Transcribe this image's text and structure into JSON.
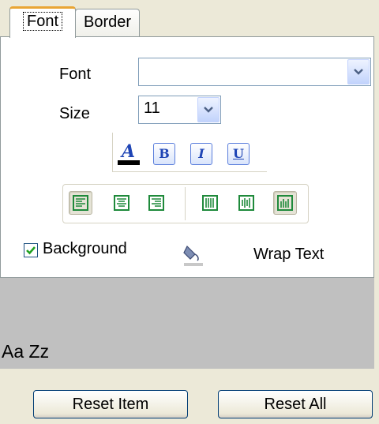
{
  "tabs": [
    {
      "label": "Font",
      "active": true
    },
    {
      "label": "Border",
      "active": false
    }
  ],
  "font": {
    "label": "Font",
    "value": ""
  },
  "size": {
    "label": "Size",
    "value": "11"
  },
  "style_buttons": [
    "B",
    "I",
    "U"
  ],
  "background": {
    "label": "Background",
    "checked": true
  },
  "wrap_text": {
    "label": "Wrap Text"
  },
  "preview": {
    "text": "Aa Zz",
    "background": "#c0c0c0"
  },
  "buttons": {
    "reset_item": "Reset Item",
    "reset_all": "Reset All"
  },
  "colors": {
    "accent": "#e9a534",
    "font_color": "#000000",
    "icon_green": "#1f8a3b",
    "icon_blue": "#1f45b5"
  }
}
